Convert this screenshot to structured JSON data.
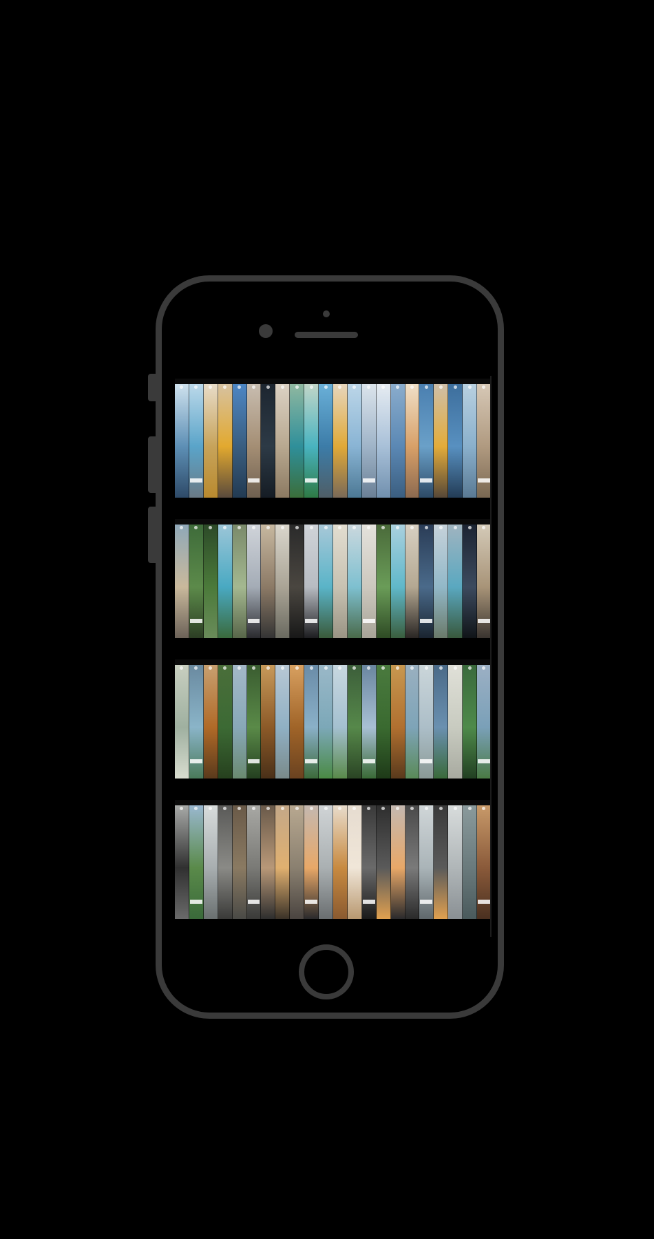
{
  "device": {
    "frame_color": "#3a3a3a",
    "background": "#000000"
  },
  "story_rows": [
    {
      "strips": [
        [
          "#cfe2ee",
          "#5d8fb5",
          "#2e4a68"
        ],
        [
          "#bcd9ea",
          "#5aa4c9",
          "#6a7a86"
        ],
        [
          "#e8dcc8",
          "#c7a35a",
          "#b98a2f"
        ],
        [
          "#d7c2a0",
          "#e2a92f",
          "#5a4a3c"
        ],
        [
          "#4d86c4",
          "#3a5e80",
          "#223a52"
        ],
        [
          "#c8bdb0",
          "#a48e74",
          "#6f6050"
        ],
        [
          "#1d2630",
          "#2d3a46",
          "#151c24"
        ],
        [
          "#dcd2c4",
          "#b8a890",
          "#8c7a62"
        ],
        [
          "#8fb8a0",
          "#2f8f9a",
          "#3b6e3a"
        ],
        [
          "#c2d6c8",
          "#49b3c0",
          "#2e7a45"
        ],
        [
          "#6ab0d8",
          "#3c7ca8",
          "#4f5e66"
        ],
        [
          "#e7d6bc",
          "#e0a938",
          "#7a6a58"
        ],
        [
          "#bcd6e8",
          "#89b4d4",
          "#4c7894"
        ],
        [
          "#dbe4ec",
          "#9fb4c8",
          "#6b8096"
        ],
        [
          "#e6ecf2",
          "#a8c0d8",
          "#7190ae"
        ],
        [
          "#8aaccc",
          "#5b88b4",
          "#3b5e80"
        ],
        [
          "#f0e0c8",
          "#d8a068",
          "#8c6a50"
        ],
        [
          "#4a7fb0",
          "#6aa0c8",
          "#2d4a66"
        ],
        [
          "#cfbfa8",
          "#e3ac3a",
          "#574838"
        ],
        [
          "#3d6e9c",
          "#5890c0",
          "#233c56"
        ],
        [
          "#b8d0e0",
          "#8ab0cc",
          "#5a7a94"
        ],
        [
          "#d6c8b6",
          "#b09a80",
          "#7a6852"
        ]
      ]
    },
    {
      "strips": [
        [
          "#8fa8b8",
          "#c9b99c",
          "#6c6258"
        ],
        [
          "#3e6b3a",
          "#5c8a4a",
          "#2c3e24"
        ],
        [
          "#2c4a28",
          "#4b7a3a",
          "#6a8c5a"
        ],
        [
          "#9cc6d8",
          "#49a9c2",
          "#3a6a3c"
        ],
        [
          "#7a8a6a",
          "#a4b890",
          "#58664a"
        ],
        [
          "#d0d4da",
          "#a4acb6",
          "#2a2a2e"
        ],
        [
          "#c7b8a0",
          "#8c7a66",
          "#343434"
        ],
        [
          "#dad6cc",
          "#aaa496",
          "#6a6a60"
        ],
        [
          "#2a2a2a",
          "#4a4640",
          "#181818"
        ],
        [
          "#cfd3d8",
          "#b8bcc2",
          "#1d1d20"
        ],
        [
          "#a8c8d8",
          "#5ab4c8",
          "#3a5a3a"
        ],
        [
          "#e2ddd0",
          "#c8c2b2",
          "#9a9484"
        ],
        [
          "#cbd8de",
          "#7ec0d0",
          "#4a6a4a"
        ],
        [
          "#e4e2dc",
          "#ccc8be",
          "#a8a498"
        ],
        [
          "#4a6a3a",
          "#6a9c58",
          "#2e4a24"
        ],
        [
          "#aad0de",
          "#60b8ca",
          "#3a5e3e"
        ],
        [
          "#d8d0c2",
          "#b4a892",
          "#2a2624"
        ],
        [
          "#2a3c56",
          "#4a6a8a",
          "#1a2430"
        ],
        [
          "#c6d2da",
          "#92b8c8",
          "#6a7a6a"
        ],
        [
          "#a0b4c0",
          "#5aa8c0",
          "#38583c"
        ],
        [
          "#1c2432",
          "#3c4a5e",
          "#101418"
        ],
        [
          "#d4cab8",
          "#a89478",
          "#3a3430"
        ]
      ]
    },
    {
      "strips": [
        [
          "#c8cfc0",
          "#9fb0a0",
          "#d8dccf"
        ],
        [
          "#6a8aa0",
          "#8ab4c8",
          "#4a7a5a"
        ],
        [
          "#c8a070",
          "#b06a28",
          "#5a3a1c"
        ],
        [
          "#4a6e3a",
          "#3c6a34",
          "#26401e"
        ],
        [
          "#a4b8c8",
          "#88a8b8",
          "#6a8a70"
        ],
        [
          "#3a5c30",
          "#5a8a48",
          "#244020"
        ],
        [
          "#c89a5a",
          "#8c5a28",
          "#4a3018"
        ],
        [
          "#b8c8d4",
          "#90b0c4",
          "#7a8a8a"
        ],
        [
          "#d8a060",
          "#a06428",
          "#6a4220"
        ],
        [
          "#6a8ca8",
          "#8ab0c8",
          "#3c6a3a"
        ],
        [
          "#9ab8c8",
          "#7ca8b8",
          "#4a8a44"
        ],
        [
          "#c8d8e0",
          "#a4c0d0",
          "#5a8a4a"
        ],
        [
          "#3c5e3a",
          "#56884a",
          "#2a4424"
        ],
        [
          "#6a86a0",
          "#a8c0d4",
          "#3a6a36"
        ],
        [
          "#4a7a3e",
          "#3a6a30",
          "#1e3a18"
        ],
        [
          "#c89850",
          "#b07030",
          "#5a3a1c"
        ],
        [
          "#9ab0c0",
          "#7ea4b8",
          "#5a8a58"
        ],
        [
          "#cbd6da",
          "#acbec8",
          "#8a9a96"
        ],
        [
          "#4a6a88",
          "#6a90b0",
          "#3a6a3a"
        ],
        [
          "#e0e0d8",
          "#c8cbc0",
          "#a8aaa0"
        ],
        [
          "#3a6a3c",
          "#4e8a4a",
          "#224022"
        ],
        [
          "#9cb0c4",
          "#7aa0b8",
          "#4a7a44"
        ]
      ]
    },
    {
      "strips": [
        [
          "#a8aaa8",
          "#303030",
          "#6a6a6a"
        ],
        [
          "#9ab8d0",
          "#5a8a4a",
          "#3a6a3a"
        ],
        [
          "#d8dcdc",
          "#a8aeb0",
          "#6a7070"
        ],
        [
          "#5a5a58",
          "#8a8a86",
          "#3a3a38"
        ],
        [
          "#6a5a48",
          "#8a7a62",
          "#4a4a46"
        ],
        [
          "#a8a8a4",
          "#7a7a76",
          "#3a3a38"
        ],
        [
          "#6a5a4a",
          "#b89878",
          "#2e2e2e"
        ],
        [
          "#c4a888",
          "#e0b070",
          "#3a3228"
        ],
        [
          "#b8a890",
          "#8a8070",
          "#4a4440"
        ],
        [
          "#c4b8b0",
          "#e8a868",
          "#2a2a2c"
        ],
        [
          "#d0d4d6",
          "#aab0b2",
          "#6a6e70"
        ],
        [
          "#e8dccc",
          "#c88a40",
          "#8a5a30"
        ],
        [
          "#e6dcd0",
          "#f0e6d8",
          "#b89870"
        ],
        [
          "#3a3a3a",
          "#6a6a6a",
          "#1a1a1a"
        ],
        [
          "#2e2e2e",
          "#5a5a5a",
          "#e0a050"
        ],
        [
          "#c4b8b0",
          "#e8a868",
          "#2a2a2c"
        ],
        [
          "#4a4a4a",
          "#7a7a7a",
          "#2a2a2a"
        ],
        [
          "#d0d6d8",
          "#aab4b8",
          "#60686c"
        ],
        [
          "#3a3a3a",
          "#5a5a5a",
          "#e0a050"
        ],
        [
          "#d8dcdc",
          "#b0b6b8",
          "#8a9094"
        ],
        [
          "#8a9a9c",
          "#6a7a7c",
          "#4a5a5c"
        ],
        [
          "#c89a6a",
          "#8a5a3a",
          "#4a3020"
        ]
      ]
    }
  ]
}
